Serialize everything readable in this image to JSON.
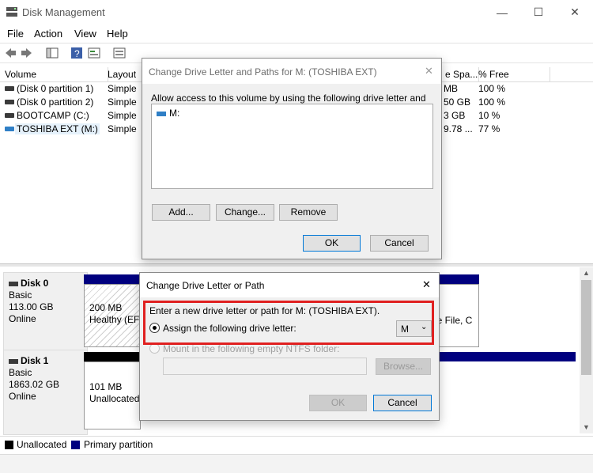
{
  "window": {
    "title": "Disk Management",
    "min_icon": "minimize-icon",
    "max_icon": "maximize-icon",
    "close_icon": "close-icon"
  },
  "menu": [
    "File",
    "Action",
    "View",
    "Help"
  ],
  "toolbar_icons": [
    "back-arrow-icon",
    "forward-arrow-icon",
    "console-tree-icon",
    "help-icon",
    "properties-icon",
    "disk-list-icon"
  ],
  "volume_columns": [
    "Volume",
    "Layout",
    "e Spa...",
    "% Free"
  ],
  "volumes": [
    {
      "name": "(Disk 0 partition 1)",
      "layout": "Simple",
      "free_space": "MB",
      "pct_free": "100 %"
    },
    {
      "name": "(Disk 0 partition 2)",
      "layout": "Simple",
      "free_space": "50 GB",
      "pct_free": "100 %"
    },
    {
      "name": "BOOTCAMP (C:)",
      "layout": "Simple",
      "free_space": "3 GB",
      "pct_free": "10 %"
    },
    {
      "name": "TOSHIBA EXT (M:)",
      "layout": "Simple",
      "free_space": "9.78 ...",
      "pct_free": "77 %"
    }
  ],
  "disks": [
    {
      "name": "Disk 0",
      "type": "Basic",
      "size": "113.00 GB",
      "status": "Online",
      "part1_size": "200 MB",
      "part1_status": "Healthy (EF",
      "right_text": "ge File, C"
    },
    {
      "name": "Disk 1",
      "type": "Basic",
      "size": "1863.02 GB",
      "status": "Online",
      "part1_size": "101 MB",
      "part1_status": "Unallocated"
    }
  ],
  "legend": {
    "unallocated": "Unallocated",
    "primary": "Primary partition",
    "unallocated_color": "#000000",
    "primary_color": "#00007f"
  },
  "dialog_paths": {
    "title": "Change Drive Letter and Paths for M: (TOSHIBA EXT)",
    "instruction": "Allow access to this volume by using the following drive letter and paths:",
    "list_items": [
      "M:"
    ],
    "add": "Add...",
    "change": "Change...",
    "remove": "Remove",
    "ok": "OK",
    "cancel": "Cancel"
  },
  "dialog_change": {
    "title": "Change Drive Letter or Path",
    "instruction": "Enter a new drive letter or path for M: (TOSHIBA EXT).",
    "assign_label": "Assign the following drive letter:",
    "assign_value": "M",
    "mount_label": "Mount in the following empty NTFS folder:",
    "folder_value": "",
    "browse": "Browse...",
    "ok": "OK",
    "cancel": "Cancel",
    "highlight_color": "#e02020"
  }
}
